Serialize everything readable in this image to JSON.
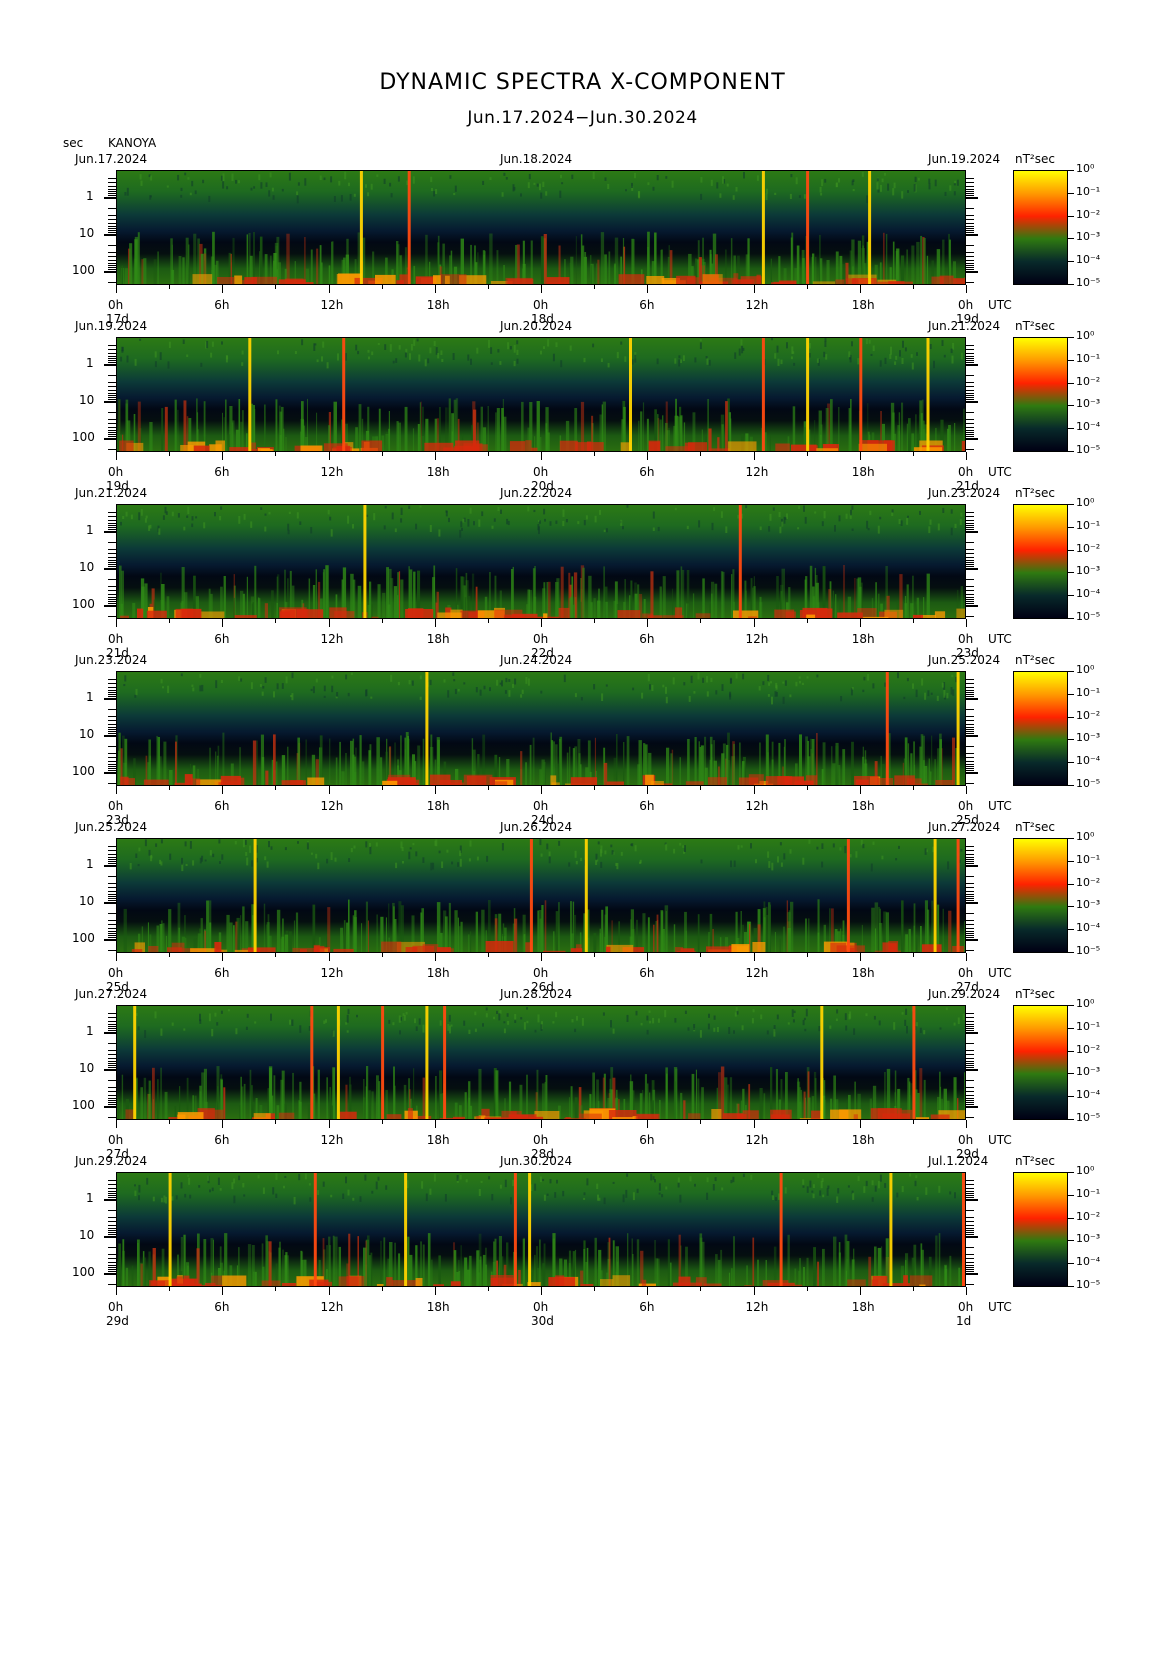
{
  "header": {
    "title": "DYNAMIC SPECTRA X-COMPONENT",
    "subtitle": "Jun.17.2024−Jun.30.2024",
    "unit_left": "sec",
    "station": "KANOYA"
  },
  "colorbar": {
    "unit": "nT²sec",
    "tick_labels": [
      "10⁰",
      "10⁻¹",
      "10⁻²",
      "10⁻³",
      "10⁻⁴",
      "10⁻⁵"
    ],
    "colors": [
      "#ffff00",
      "#ff9900",
      "#ff2200",
      "#2f7a10",
      "#082a2a",
      "#000014"
    ]
  },
  "y_axis": {
    "tick_labels": [
      "1",
      "10",
      "100"
    ],
    "scale": "log",
    "unit": "sec"
  },
  "x_axis": {
    "tick_labels": [
      "0h",
      "6h",
      "12h",
      "18h",
      "0h",
      "6h",
      "12h",
      "18h",
      "0h"
    ],
    "utc_label": "UTC"
  },
  "chart_data": {
    "type": "heatmap",
    "description_of_axes": "x: time (UTC), y: period (sec, log), color: power (nT^2 sec)",
    "panels": [
      {
        "left_date": "Jun.17.2024",
        "mid_date": "Jun.18.2024",
        "right_date": "Jun.19.2024",
        "day_labels": [
          "17d",
          "18d",
          "19d"
        ],
        "spikes_hours": [
          13.8,
          16.5,
          36.5,
          39,
          42.5
        ]
      },
      {
        "left_date": "Jun.19.2024",
        "mid_date": "Jun.20.2024",
        "right_date": "Jun.21.2024",
        "day_labels": [
          "19d",
          "20d",
          "21d"
        ],
        "spikes_hours": [
          7.5,
          12.8,
          29,
          36.5,
          39,
          42,
          45.8
        ]
      },
      {
        "left_date": "Jun.21.2024",
        "mid_date": "Jun.22.2024",
        "right_date": "Jun.23.2024",
        "day_labels": [
          "21d",
          "22d",
          "23d"
        ],
        "spikes_hours": [
          14,
          35.2
        ]
      },
      {
        "left_date": "Jun.23.2024",
        "mid_date": "Jun.24.2024",
        "right_date": "Jun.25.2024",
        "day_labels": [
          "23d",
          "24d",
          "25d"
        ],
        "spikes_hours": [
          17.5,
          43.5,
          47.5
        ]
      },
      {
        "left_date": "Jun.25.2024",
        "mid_date": "Jun.26.2024",
        "right_date": "Jun.27.2024",
        "day_labels": [
          "25d",
          "26d",
          "27d"
        ],
        "spikes_hours": [
          7.8,
          23.4,
          26.5,
          41.3,
          46.2,
          47.5
        ]
      },
      {
        "left_date": "Jun.27.2024",
        "mid_date": "Jun.28.2024",
        "right_date": "Jun.29.2024",
        "day_labels": [
          "27d",
          "28d",
          "29d"
        ],
        "spikes_hours": [
          1,
          11,
          12.5,
          15,
          17.5,
          18.5,
          39.8,
          45
        ]
      },
      {
        "left_date": "Jun.29.2024",
        "mid_date": "Jun.30.2024",
        "right_date": "Jul.1.2024",
        "day_labels": [
          "29d",
          "30d",
          "1d"
        ],
        "spikes_hours": [
          3,
          11.2,
          16.3,
          22.5,
          23.3,
          37.5,
          43.7,
          47.8
        ]
      }
    ]
  }
}
